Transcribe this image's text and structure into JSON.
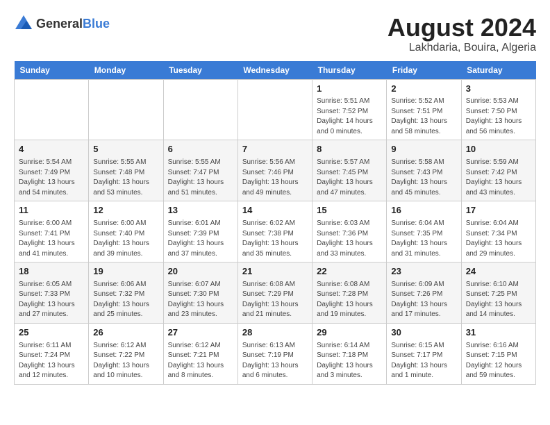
{
  "logo": {
    "general": "General",
    "blue": "Blue"
  },
  "title": "August 2024",
  "subtitle": "Lakhdaria, Bouira, Algeria",
  "header_color": "#3a7bd5",
  "days_of_week": [
    "Sunday",
    "Monday",
    "Tuesday",
    "Wednesday",
    "Thursday",
    "Friday",
    "Saturday"
  ],
  "weeks": [
    [
      {
        "day": "",
        "info": ""
      },
      {
        "day": "",
        "info": ""
      },
      {
        "day": "",
        "info": ""
      },
      {
        "day": "",
        "info": ""
      },
      {
        "day": "1",
        "info": "Sunrise: 5:51 AM\nSunset: 7:52 PM\nDaylight: 14 hours\nand 0 minutes."
      },
      {
        "day": "2",
        "info": "Sunrise: 5:52 AM\nSunset: 7:51 PM\nDaylight: 13 hours\nand 58 minutes."
      },
      {
        "day": "3",
        "info": "Sunrise: 5:53 AM\nSunset: 7:50 PM\nDaylight: 13 hours\nand 56 minutes."
      }
    ],
    [
      {
        "day": "4",
        "info": "Sunrise: 5:54 AM\nSunset: 7:49 PM\nDaylight: 13 hours\nand 54 minutes."
      },
      {
        "day": "5",
        "info": "Sunrise: 5:55 AM\nSunset: 7:48 PM\nDaylight: 13 hours\nand 53 minutes."
      },
      {
        "day": "6",
        "info": "Sunrise: 5:55 AM\nSunset: 7:47 PM\nDaylight: 13 hours\nand 51 minutes."
      },
      {
        "day": "7",
        "info": "Sunrise: 5:56 AM\nSunset: 7:46 PM\nDaylight: 13 hours\nand 49 minutes."
      },
      {
        "day": "8",
        "info": "Sunrise: 5:57 AM\nSunset: 7:45 PM\nDaylight: 13 hours\nand 47 minutes."
      },
      {
        "day": "9",
        "info": "Sunrise: 5:58 AM\nSunset: 7:43 PM\nDaylight: 13 hours\nand 45 minutes."
      },
      {
        "day": "10",
        "info": "Sunrise: 5:59 AM\nSunset: 7:42 PM\nDaylight: 13 hours\nand 43 minutes."
      }
    ],
    [
      {
        "day": "11",
        "info": "Sunrise: 6:00 AM\nSunset: 7:41 PM\nDaylight: 13 hours\nand 41 minutes."
      },
      {
        "day": "12",
        "info": "Sunrise: 6:00 AM\nSunset: 7:40 PM\nDaylight: 13 hours\nand 39 minutes."
      },
      {
        "day": "13",
        "info": "Sunrise: 6:01 AM\nSunset: 7:39 PM\nDaylight: 13 hours\nand 37 minutes."
      },
      {
        "day": "14",
        "info": "Sunrise: 6:02 AM\nSunset: 7:38 PM\nDaylight: 13 hours\nand 35 minutes."
      },
      {
        "day": "15",
        "info": "Sunrise: 6:03 AM\nSunset: 7:36 PM\nDaylight: 13 hours\nand 33 minutes."
      },
      {
        "day": "16",
        "info": "Sunrise: 6:04 AM\nSunset: 7:35 PM\nDaylight: 13 hours\nand 31 minutes."
      },
      {
        "day": "17",
        "info": "Sunrise: 6:04 AM\nSunset: 7:34 PM\nDaylight: 13 hours\nand 29 minutes."
      }
    ],
    [
      {
        "day": "18",
        "info": "Sunrise: 6:05 AM\nSunset: 7:33 PM\nDaylight: 13 hours\nand 27 minutes."
      },
      {
        "day": "19",
        "info": "Sunrise: 6:06 AM\nSunset: 7:32 PM\nDaylight: 13 hours\nand 25 minutes."
      },
      {
        "day": "20",
        "info": "Sunrise: 6:07 AM\nSunset: 7:30 PM\nDaylight: 13 hours\nand 23 minutes."
      },
      {
        "day": "21",
        "info": "Sunrise: 6:08 AM\nSunset: 7:29 PM\nDaylight: 13 hours\nand 21 minutes."
      },
      {
        "day": "22",
        "info": "Sunrise: 6:08 AM\nSunset: 7:28 PM\nDaylight: 13 hours\nand 19 minutes."
      },
      {
        "day": "23",
        "info": "Sunrise: 6:09 AM\nSunset: 7:26 PM\nDaylight: 13 hours\nand 17 minutes."
      },
      {
        "day": "24",
        "info": "Sunrise: 6:10 AM\nSunset: 7:25 PM\nDaylight: 13 hours\nand 14 minutes."
      }
    ],
    [
      {
        "day": "25",
        "info": "Sunrise: 6:11 AM\nSunset: 7:24 PM\nDaylight: 13 hours\nand 12 minutes."
      },
      {
        "day": "26",
        "info": "Sunrise: 6:12 AM\nSunset: 7:22 PM\nDaylight: 13 hours\nand 10 minutes."
      },
      {
        "day": "27",
        "info": "Sunrise: 6:12 AM\nSunset: 7:21 PM\nDaylight: 13 hours\nand 8 minutes."
      },
      {
        "day": "28",
        "info": "Sunrise: 6:13 AM\nSunset: 7:19 PM\nDaylight: 13 hours\nand 6 minutes."
      },
      {
        "day": "29",
        "info": "Sunrise: 6:14 AM\nSunset: 7:18 PM\nDaylight: 13 hours\nand 3 minutes."
      },
      {
        "day": "30",
        "info": "Sunrise: 6:15 AM\nSunset: 7:17 PM\nDaylight: 13 hours\nand 1 minute."
      },
      {
        "day": "31",
        "info": "Sunrise: 6:16 AM\nSunset: 7:15 PM\nDaylight: 12 hours\nand 59 minutes."
      }
    ]
  ]
}
